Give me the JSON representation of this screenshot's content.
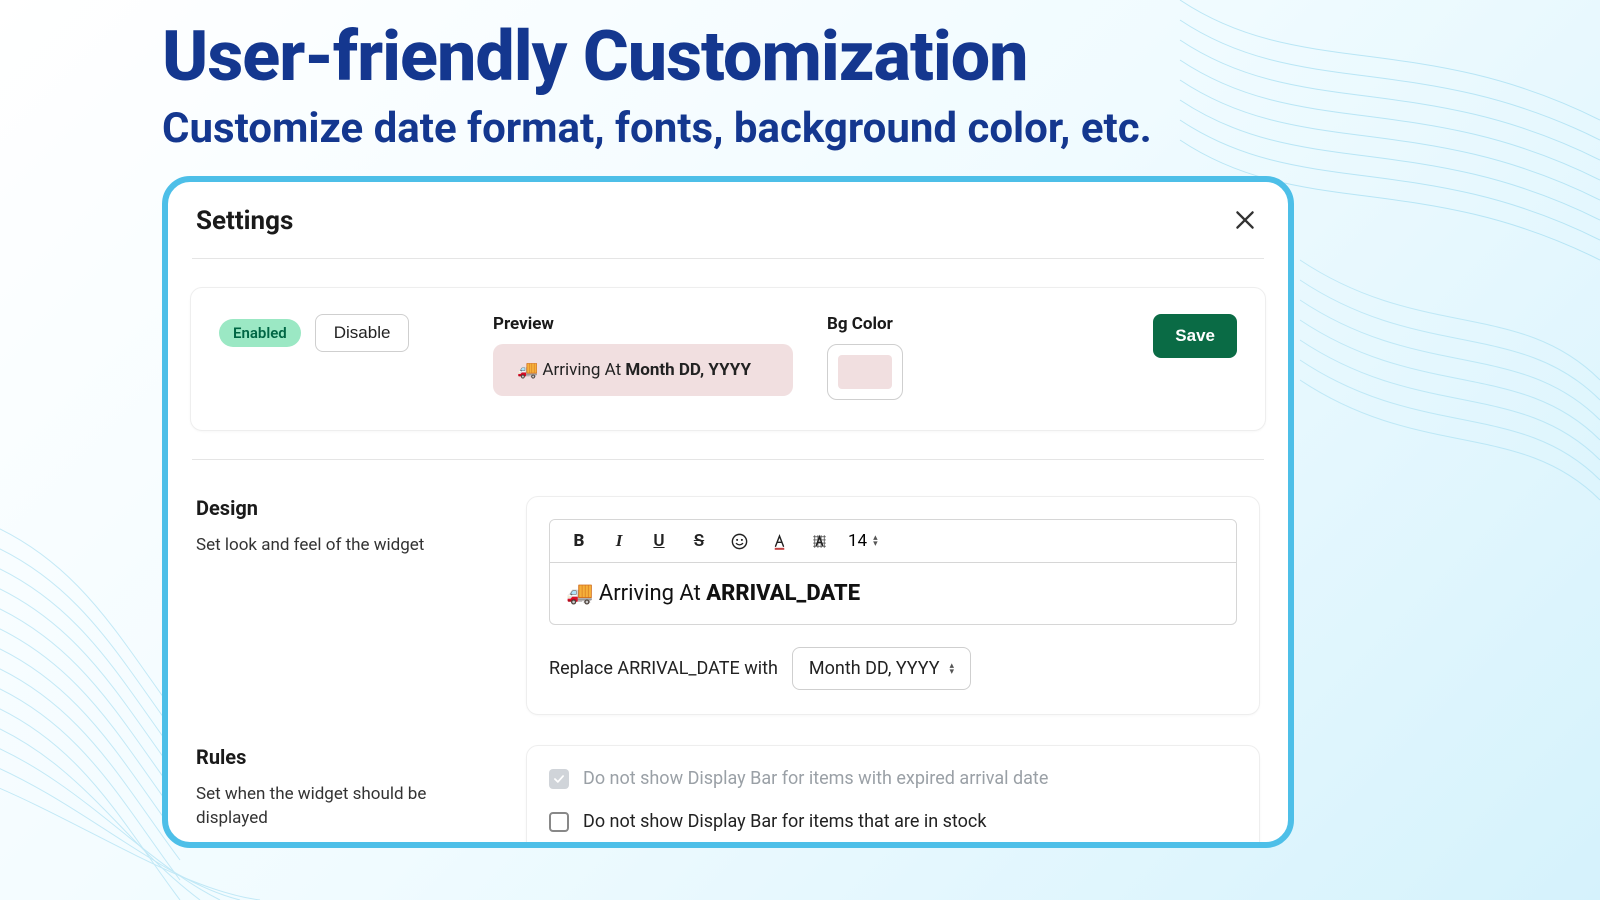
{
  "hero": {
    "title": "User-friendly Customization",
    "subtitle": "Customize date format, fonts, background color, etc."
  },
  "panel": {
    "title": "Settings",
    "enabled_label": "Enabled",
    "disable_label": "Disable",
    "preview_label": "Preview",
    "preview_prefix": "🚚 Arriving At ",
    "preview_bold": "Month DD, YYYY",
    "bg_label": "Bg Color",
    "bg_hex": "#f1dfe0",
    "save_label": "Save"
  },
  "design": {
    "title": "Design",
    "desc": "Set look and feel of the widget",
    "font_size": "14",
    "editor_prefix": "🚚 Arriving At ",
    "editor_token": "ARRIVAL_DATE",
    "replace_label": "Replace ARRIVAL_DATE with",
    "replace_value": "Month DD, YYYY"
  },
  "rules": {
    "title": "Rules",
    "desc": "Set when the widget should be displayed",
    "items": [
      {
        "label": "Do not show Display Bar for items with expired arrival date",
        "checked": true,
        "locked": true
      },
      {
        "label": "Do not show Display Bar for items that are in stock",
        "checked": false,
        "locked": false
      }
    ]
  }
}
